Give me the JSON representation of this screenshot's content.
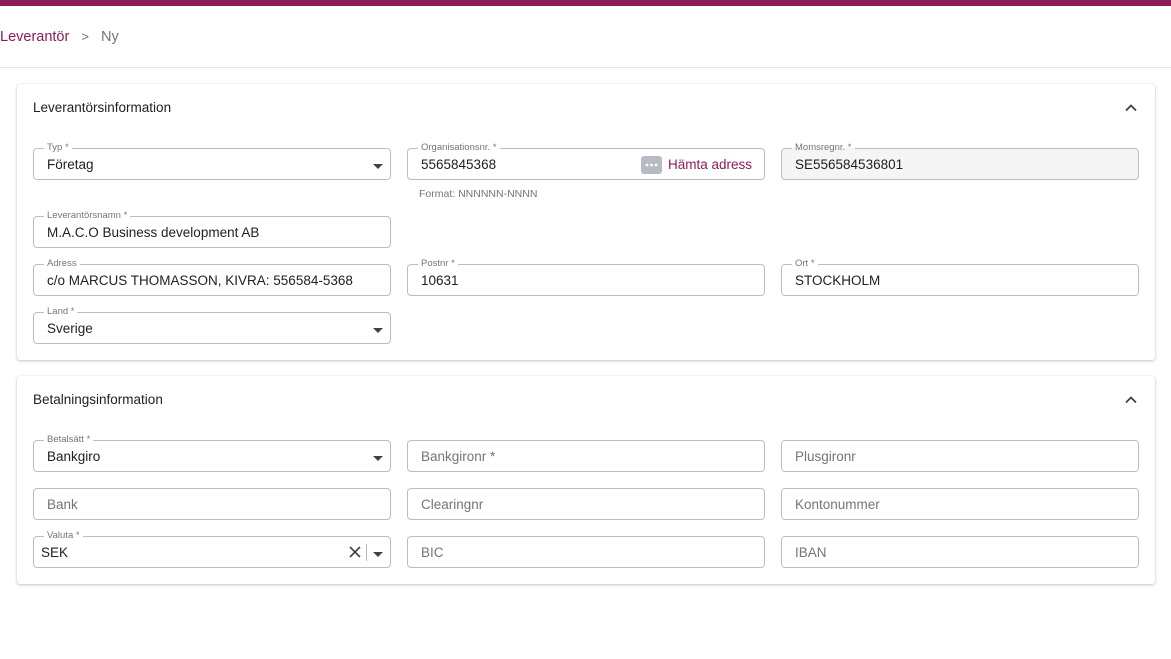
{
  "breadcrumb": {
    "root": "Leverantör",
    "separator": ">",
    "current": "Ny"
  },
  "colors": {
    "brand": "#8e1b58",
    "border": "#bdbdbd",
    "muted": "#757575"
  },
  "supplier_section": {
    "title": "Leverantörsinformation",
    "type": {
      "label": "Typ *",
      "value": "Företag"
    },
    "org_number": {
      "label": "Organisationsnr. *",
      "value": "5565845368",
      "action_label": "Hämta adress",
      "hint": "Format: NNNNNN-NNNN"
    },
    "vat_number": {
      "label": "Momsregnr. *",
      "value": "SE556584536801"
    },
    "supplier_name": {
      "label": "Leverantörsnamn *",
      "value": "M.A.C.O Business development AB"
    },
    "address": {
      "label": "Adress",
      "value": "c/o MARCUS THOMASSON, KIVRA: 556584-5368"
    },
    "postal_code": {
      "label": "Postnr *",
      "value": "10631"
    },
    "city": {
      "label": "Ort *",
      "value": "STOCKHOLM"
    },
    "country": {
      "label": "Land *",
      "value": "Sverige"
    }
  },
  "payment_section": {
    "title": "Betalningsinformation",
    "payment_method": {
      "label": "Betalsätt *",
      "value": "Bankgiro"
    },
    "bankgiro": {
      "placeholder": "Bankgironr *"
    },
    "plusgiro": {
      "placeholder": "Plusgironr"
    },
    "bank": {
      "placeholder": "Bank"
    },
    "clearing": {
      "placeholder": "Clearingnr"
    },
    "account": {
      "placeholder": "Kontonummer"
    },
    "currency": {
      "label": "Valuta *",
      "value": "SEK"
    },
    "bic": {
      "placeholder": "BIC"
    },
    "iban": {
      "placeholder": "IBAN"
    }
  }
}
